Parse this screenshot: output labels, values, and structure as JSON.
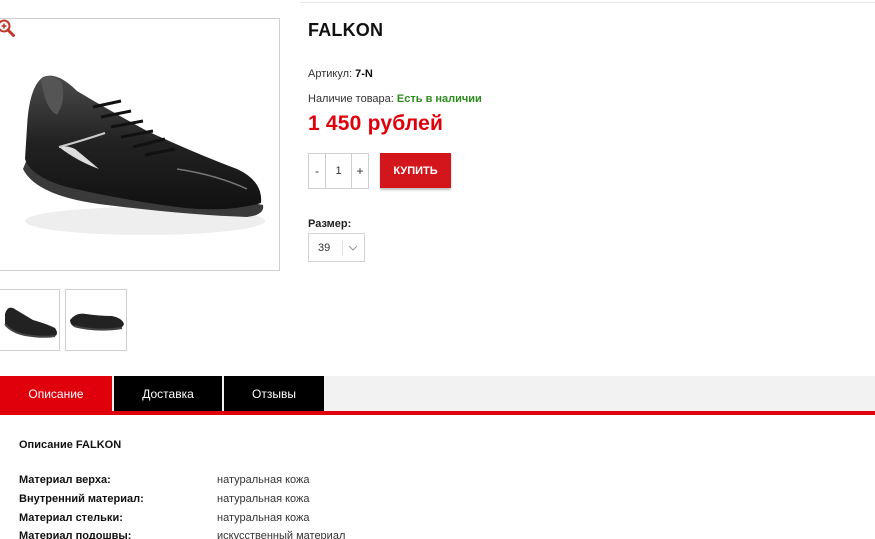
{
  "product": {
    "title": "FALKON",
    "sku_label": "Артикул:",
    "sku_value": "7-N",
    "stock_label": "Наличие товара:",
    "stock_value": "Есть в наличии",
    "price": "1 450 рублей",
    "colors": {
      "price": "#e0000b",
      "in_stock": "#2e8b1f",
      "buy_button": "#d2161c"
    }
  },
  "quantity": {
    "minus": "-",
    "value": "1",
    "plus": "+"
  },
  "buy_button": {
    "label": "КУПИТЬ"
  },
  "size": {
    "label": "Размер:",
    "selected": "39"
  },
  "tabs": [
    {
      "label": "Описание",
      "active": true
    },
    {
      "label": "Доставка",
      "active": false
    },
    {
      "label": "Отзывы",
      "active": false
    }
  ],
  "description": {
    "title": "Описание FALKON",
    "specs": [
      {
        "key": "Материал верха:",
        "value": "натуральная кожа"
      },
      {
        "key": "Внутренний материал:",
        "value": "натуральная кожа"
      },
      {
        "key": "Материал стельки:",
        "value": "натуральная кожа"
      },
      {
        "key": "Материал подошвы:",
        "value": "искусственный материал"
      }
    ]
  },
  "icons": {
    "zoom": "zoom-in-icon",
    "select": "chevron-down-icon"
  }
}
